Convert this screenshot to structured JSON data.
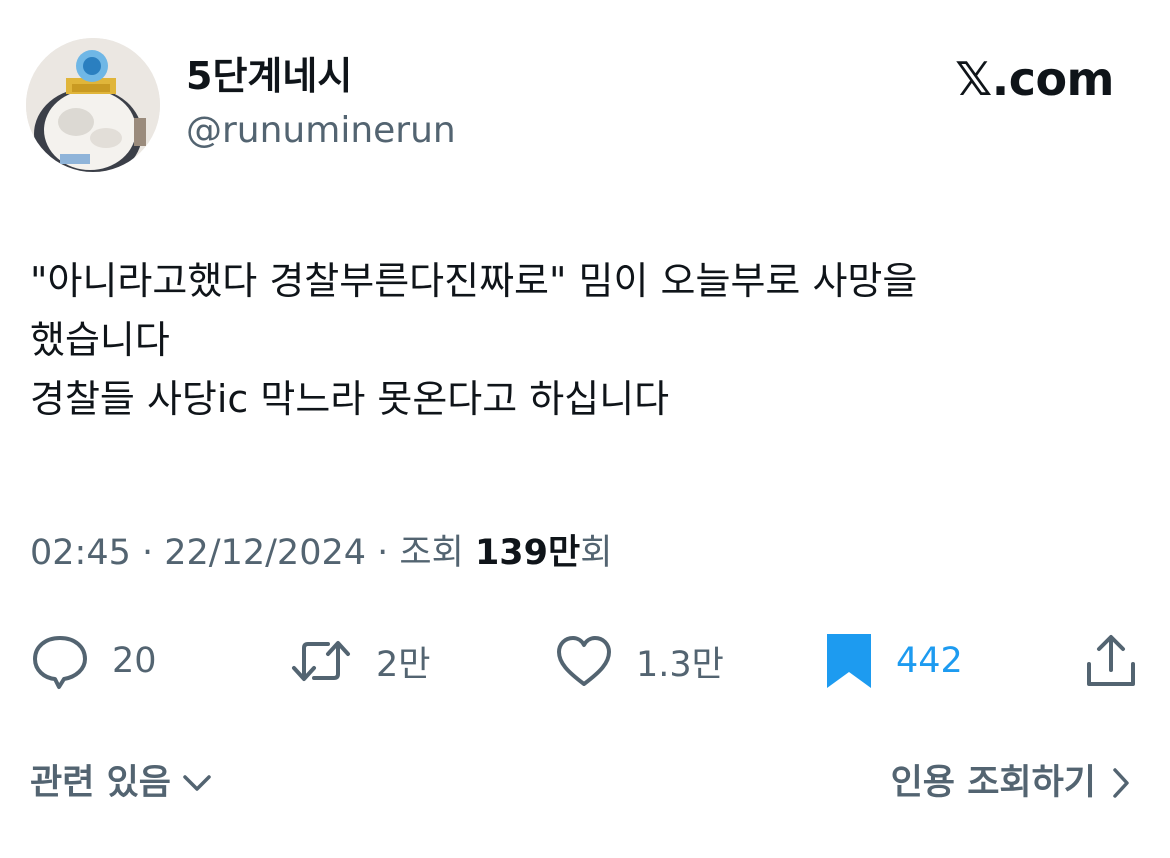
{
  "author": {
    "display_name": "5단계네시",
    "handle": "@runuminerun"
  },
  "brand": {
    "logo_text": "𝕏.com"
  },
  "tweet": {
    "lines": [
      "\"아니라고했다 경찰부른다진짜로\" 밈이 오늘부로 사망을",
      "했습니다",
      "경찰들 사당ic 막느라 못온다고 하십니다"
    ]
  },
  "meta": {
    "time": "02:45",
    "separator": " · ",
    "date": "22/12/2024",
    "views_label": "조회",
    "views_number": "139만",
    "views_suffix": "회"
  },
  "actions": {
    "replies": "20",
    "reposts": "2만",
    "likes": "1.3만",
    "bookmarks": "442"
  },
  "footer": {
    "related": "관련 있음",
    "quotes": "인용 조회하기"
  },
  "colors": {
    "text": "#0f1419",
    "secondary": "#536471",
    "accent": "#1d9bf0"
  }
}
